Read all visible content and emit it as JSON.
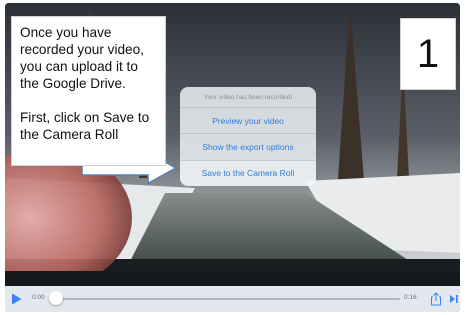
{
  "callout": {
    "line1": "Once you have recorded your video, you can upload it to the Google Drive.",
    "line2": "First, click on Save to the Camera Roll"
  },
  "step": {
    "number": "1"
  },
  "action_sheet": {
    "title": "Your video has been recorded!",
    "options": [
      "Preview your video",
      "Show the export options",
      "Save to the Camera Roll"
    ],
    "highlighted_option": "Save to the Camera Roll",
    "text_color": "#2f7bd8"
  },
  "player": {
    "current_time": "0:00",
    "total_time": "0:16",
    "progress": 0.0,
    "accent_color": "#3b82f6",
    "icons": [
      "play-icon",
      "share-icon",
      "next-icon"
    ]
  }
}
